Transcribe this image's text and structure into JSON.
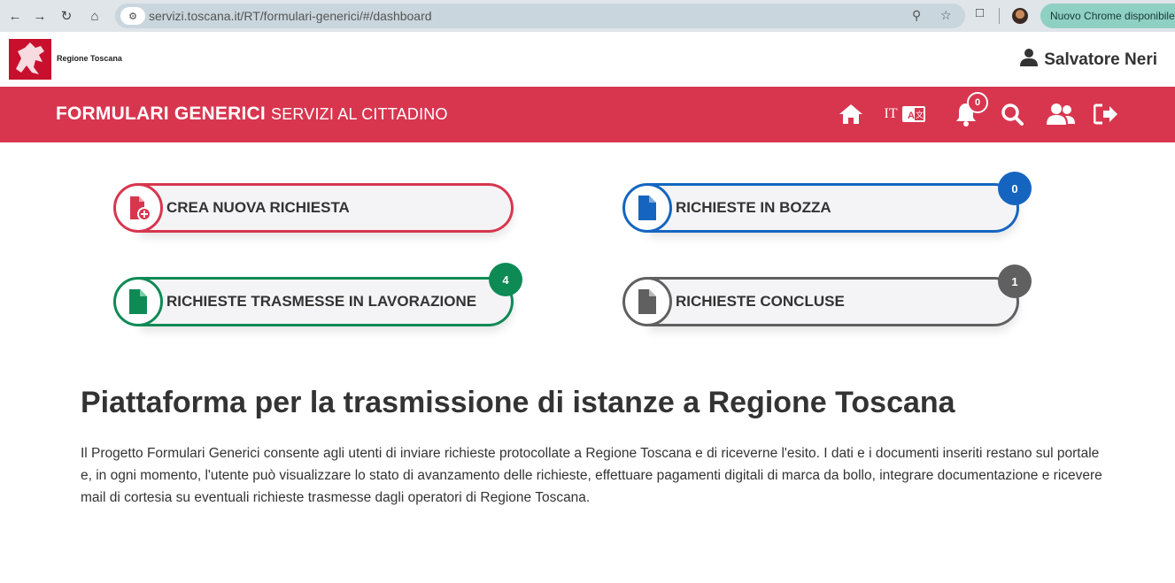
{
  "browser": {
    "url": "servizi.toscana.it/RT/formulari-generici/#/dashboard",
    "update_label": "Nuovo Chrome disponibile"
  },
  "header": {
    "logo_text": "Regione Toscana",
    "user_name": "Salvatore Neri"
  },
  "nav": {
    "title": "FORMULARI GENERICI",
    "subtitle": "SERVIZI AL CITTADINO",
    "language": "IT",
    "notifications_count": "0"
  },
  "cards": [
    {
      "label": "CREA NUOVA RICHIESTA",
      "color": "#d8364f",
      "icon": "file-plus-icon"
    },
    {
      "label": "RICHIESTE IN BOZZA",
      "color": "#1565c0",
      "icon": "file-icon",
      "badge": "0"
    },
    {
      "label": "RICHIESTE TRASMESSE IN LAVORAZIONE",
      "color": "#0e8a55",
      "icon": "file-icon",
      "badge": "4"
    },
    {
      "label": "RICHIESTE CONCLUSE",
      "color": "#606060",
      "icon": "file-icon",
      "badge": "1"
    }
  ],
  "content": {
    "title": "Piattaforma per la trasmissione di istanze a Regione Toscana",
    "description": "Il Progetto Formulari Generici consente agli utenti di inviare richieste protocollate a Regione Toscana e di riceverne l'esito. I dati e i documenti inseriti restano sul portale e, in ogni momento, l'utente può visualizzare lo stato di avanzamento delle richieste, effettuare pagamenti digitali di marca da bollo, integrare documentazione e ricevere mail di cortesia su eventuali richieste trasmesse dagli operatori di Regione Toscana."
  }
}
